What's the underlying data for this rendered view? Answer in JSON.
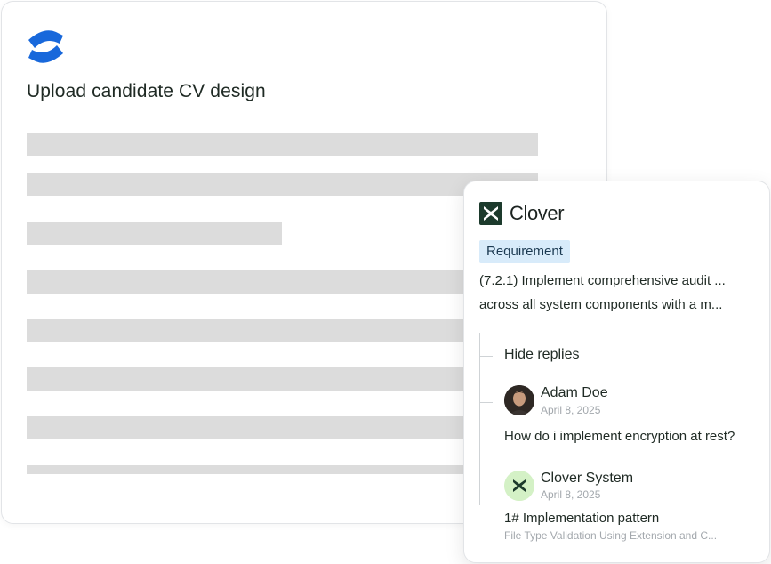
{
  "document": {
    "app_icon": "confluence-logo",
    "title": "Upload candidate CV design"
  },
  "panel": {
    "brand_icon": "clover-logo",
    "brand_name": "Clover",
    "badge": "Requirement",
    "requirement_line1": "(7.2.1) Implement comprehensive audit ...",
    "requirement_line2": "across all system components with a m...",
    "hide_replies": "Hide replies",
    "replies": [
      {
        "author": "Adam Doe",
        "date": "April 8, 2025",
        "avatar": "user-avatar-photo",
        "text": "How do i implement encryption at rest?"
      },
      {
        "author": "Clover System",
        "date": "April 8, 2025",
        "avatar": "clover-logo",
        "text": "1# Implementation pattern",
        "subtext": "File Type Validation Using Extension and C..."
      }
    ]
  },
  "colors": {
    "confluence_blue": "#1868db",
    "clover_dark_green": "#1c3a2c",
    "badge_bg": "#d8ebfa",
    "skeleton_gray": "#dcdcdc"
  }
}
